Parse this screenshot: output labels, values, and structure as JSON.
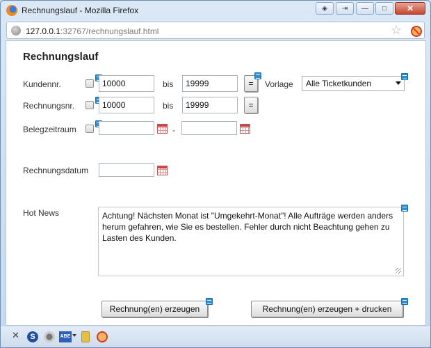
{
  "window": {
    "title": "Rechnungslauf - Mozilla Firefox",
    "url_host": "127.0.0.1",
    "url_rest": ":32767/rechnungslauf.html",
    "controls": {
      "minimize": "—",
      "maximize": "□",
      "close": "✕",
      "btn1": "◈",
      "btn2": "⇥"
    }
  },
  "form": {
    "heading": "Rechnungslauf",
    "kundennr": {
      "label": "Kundennr.",
      "from": "10000",
      "bis_label": "bis",
      "to": "19999",
      "eq": "="
    },
    "rechnungsnr": {
      "label": "Rechnungsnr.",
      "from": "10000",
      "bis_label": "bis",
      "to": "19999",
      "eq": "="
    },
    "vorlage": {
      "label": "Vorlage",
      "selected": "Alle Ticketkunden"
    },
    "belegzeitraum": {
      "label": "Belegzeitraum",
      "from": "",
      "dash": "-",
      "to": ""
    },
    "rechnungsdatum": {
      "label": "Rechnungsdatum",
      "value": ""
    },
    "hotnews": {
      "label": "Hot News",
      "text": "Achtung! Nächsten Monat ist \"Umgekehrt-Monat\"! Alle Aufträge werden anders herum gefahren, wie Sie es bestellen. Fehler durch nicht Beachtung gehen zu Lasten des Kunden."
    },
    "buttons": {
      "create": "Rechnung(en) erzeugen",
      "create_print": "Rechnung(en) erzeugen + drucken"
    }
  },
  "statusbar": {
    "close": "✕",
    "s": "S",
    "abe": "ABE"
  }
}
